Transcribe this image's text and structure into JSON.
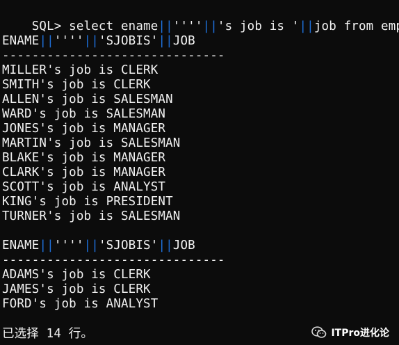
{
  "terminal": {
    "prompt_prefix": "SQL> select ename",
    "prompt_mid1": "''''",
    "prompt_mid2": "'s job is '",
    "prompt_suffix": "job from emp;",
    "pipe": "||",
    "blocks": [
      {
        "header": {
          "c1": "ENAME",
          "c2": "''''",
          "c3": "'SJOBIS'",
          "c4": "JOB"
        },
        "separator": "------------------------------",
        "rows": [
          "MILLER's job is CLERK",
          "SMITH's job is CLERK",
          "ALLEN's job is SALESMAN",
          "WARD's job is SALESMAN",
          "JONES's job is MANAGER",
          "MARTIN's job is SALESMAN",
          "BLAKE's job is MANAGER",
          "CLARK's job is MANAGER",
          "SCOTT's job is ANALYST",
          "KING's job is PRESIDENT",
          "TURNER's job is SALESMAN"
        ]
      },
      {
        "header": {
          "c1": "ENAME",
          "c2": "''''",
          "c3": "'SJOBIS'",
          "c4": "JOB"
        },
        "separator": "------------------------------",
        "rows": [
          "ADAMS's job is CLERK",
          "JAMES's job is CLERK",
          "FORD's job is ANALYST"
        ]
      }
    ],
    "footer": "已选择 14 行。",
    "pipe_color": "#1e6fd9"
  },
  "watermark": {
    "icon": "wechat-icon",
    "text": "ITPro进化论"
  }
}
